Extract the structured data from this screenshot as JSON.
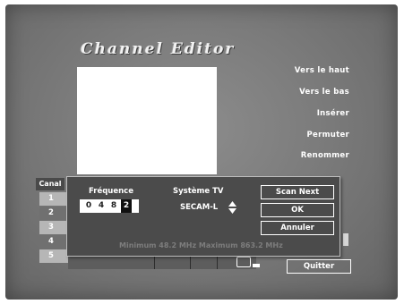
{
  "title": "Channel Editor",
  "menu": [
    {
      "label": "Vers le haut"
    },
    {
      "label": "Vers le bas"
    },
    {
      "label": "Insérer"
    },
    {
      "label": "Permuter"
    },
    {
      "label": "Renommer"
    }
  ],
  "channels": {
    "header": "Canal",
    "rows": [
      "1",
      "2",
      "3",
      "4",
      "5"
    ]
  },
  "dialog": {
    "frequency_label": "Fréquence",
    "frequency_digits": [
      "0",
      "4",
      "8",
      "2"
    ],
    "system_label": "Système TV",
    "system_value": "SECAM-L",
    "buttons": {
      "scan_next": "Scan Next",
      "ok": "OK",
      "cancel": "Annuler"
    },
    "range_text": "Minimum 48.2  MHz  Maximum 863.2  MHz"
  },
  "footer": {
    "quit_label": "Quitter"
  },
  "icons": {
    "updown": "up-down-arrows-icon",
    "tv": "tv-icon"
  },
  "colors": {
    "background": "#7b7b7b",
    "dialog": "#4b4b4b",
    "text": "#ffffff"
  }
}
